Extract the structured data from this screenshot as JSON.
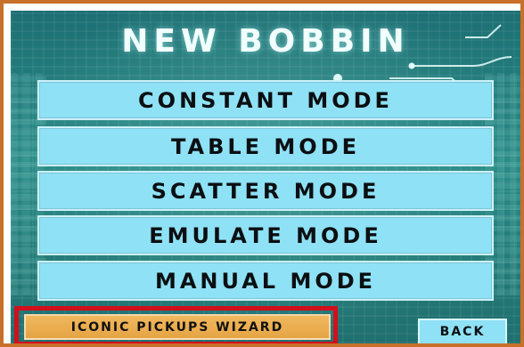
{
  "window": {
    "title": "NEW BOBBIN"
  },
  "menu": {
    "items": [
      {
        "label": "CONSTANT MODE"
      },
      {
        "label": "TABLE MODE"
      },
      {
        "label": "SCATTER MODE"
      },
      {
        "label": "EMULATE MODE"
      },
      {
        "label": "MANUAL MODE"
      }
    ]
  },
  "footer": {
    "wizard_label": "ICONIC PICKUPS WIZARD",
    "back_label": "BACK"
  },
  "colors": {
    "outer_border": "#c8702a",
    "screen_teal": "#2b8a86",
    "mode_button_bg": "#8fe1f5",
    "wizard_button_bg": "#e4a444",
    "highlight_red": "#d20f1c"
  },
  "icons": {
    "circuit_decoration": "circuit-trace-icon"
  }
}
